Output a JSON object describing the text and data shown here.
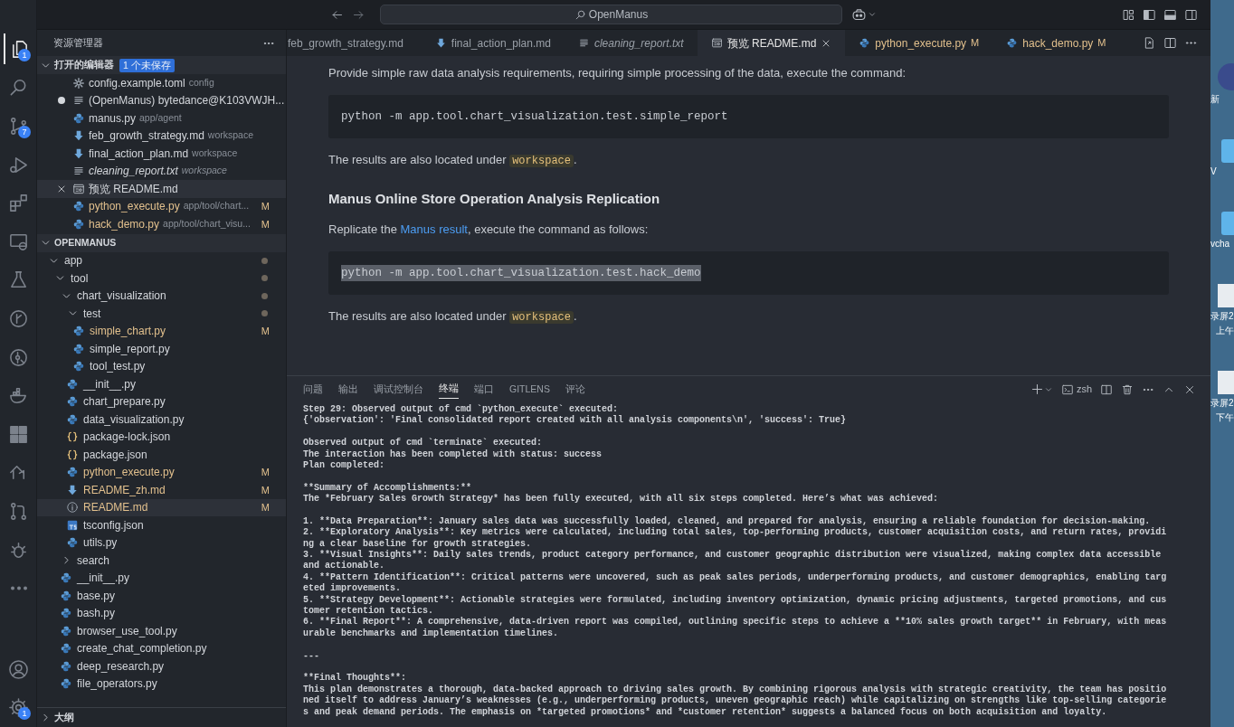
{
  "title_bar": {
    "search": "OpenManus"
  },
  "activity_bar": {
    "items": [
      {
        "kind": "files",
        "selected": true,
        "badge": "1"
      },
      {
        "kind": "search",
        "selected": false
      },
      {
        "kind": "source_control",
        "selected": false,
        "badge": "7"
      },
      {
        "kind": "run_debug",
        "selected": false
      },
      {
        "kind": "extensions",
        "selected": false
      },
      {
        "kind": "remote",
        "selected": false
      },
      {
        "kind": "testing",
        "selected": false
      },
      {
        "kind": "git_graph",
        "selected": false
      },
      {
        "kind": "gitlens",
        "selected": false
      },
      {
        "kind": "docker",
        "selected": false
      },
      {
        "kind": "grid",
        "selected": false
      },
      {
        "kind": "remote_repo",
        "selected": false
      },
      {
        "kind": "pull_request",
        "selected": false
      },
      {
        "kind": "bug",
        "selected": false
      },
      {
        "kind": "more",
        "selected": false
      }
    ],
    "bottom": [
      {
        "kind": "account",
        "selected": false
      },
      {
        "kind": "settings",
        "selected": false,
        "badge": "1"
      }
    ]
  },
  "explorer": {
    "title": "资源管理器",
    "open_editors": {
      "title": "打开的编辑器",
      "badge": "1 个未保存",
      "expanded": true,
      "items": [
        {
          "kind": "toml",
          "name": "config.example.toml",
          "path": "config",
          "dirty": false,
          "preview": false,
          "selected": false
        },
        {
          "kind": "text",
          "name": "(OpenManus) bytedance@K103VWJH...",
          "dirty": true,
          "preview": false,
          "selected": false
        },
        {
          "kind": "python",
          "name": "manus.py",
          "path": "app/agent",
          "dirty": false,
          "preview": false,
          "selected": false
        },
        {
          "kind": "markdown",
          "name": "feb_growth_strategy.md",
          "path": "workspace",
          "dirty": false,
          "preview": false,
          "selected": false
        },
        {
          "kind": "markdown",
          "name": "final_action_plan.md",
          "path": "workspace",
          "dirty": false,
          "preview": false,
          "selected": false
        },
        {
          "kind": "text",
          "name": "cleaning_report.txt",
          "path": "workspace",
          "dirty": false,
          "preview": true,
          "selected": false
        },
        {
          "kind": "preview",
          "name": "预览 README.md",
          "dirty": false,
          "preview": false,
          "selected": true
        },
        {
          "kind": "python",
          "name": "python_execute.py",
          "path": "app/tool/chart...",
          "git": "M",
          "dirty": false,
          "preview": false,
          "selected": false
        },
        {
          "kind": "python",
          "name": "hack_demo.py",
          "path": "app/tool/chart_visu...",
          "git": "M",
          "dirty": false,
          "preview": false,
          "selected": false
        }
      ]
    },
    "project": {
      "title": "OPENMANUS",
      "expanded": true,
      "tree": [
        {
          "kind": "folder",
          "name": "app",
          "expanded": true,
          "modified": true,
          "selected": false,
          "children": [
            {
              "kind": "folder",
              "name": "tool",
              "expanded": true,
              "modified": true,
              "selected": false,
              "children": [
                {
                  "kind": "folder",
                  "name": "chart_visualization",
                  "expanded": true,
                  "modified": true,
                  "selected": false,
                  "children": [
                    {
                      "kind": "folder",
                      "name": "test",
                      "expanded": true,
                      "modified": true,
                      "selected": false,
                      "children": [
                        {
                          "kind": "python",
                          "name": "simple_chart.py",
                          "git": "M",
                          "selected": false
                        },
                        {
                          "kind": "python",
                          "name": "simple_report.py",
                          "selected": false
                        },
                        {
                          "kind": "python",
                          "name": "tool_test.py",
                          "selected": false
                        }
                      ]
                    },
                    {
                      "kind": "python",
                      "name": "__init__.py",
                      "selected": false
                    },
                    {
                      "kind": "python",
                      "name": "chart_prepare.py",
                      "selected": false
                    },
                    {
                      "kind": "python",
                      "name": "data_visualization.py",
                      "selected": false
                    },
                    {
                      "kind": "json",
                      "name": "package-lock.json",
                      "selected": false
                    },
                    {
                      "kind": "json",
                      "name": "package.json",
                      "selected": false
                    },
                    {
                      "kind": "python",
                      "name": "python_execute.py",
                      "git": "M",
                      "selected": false
                    },
                    {
                      "kind": "markdown",
                      "name": "README_zh.md",
                      "git": "M",
                      "selected": false
                    },
                    {
                      "kind": "info",
                      "name": "README.md",
                      "git": "M",
                      "selected": true
                    },
                    {
                      "kind": "ts",
                      "name": "tsconfig.json",
                      "selected": false
                    },
                    {
                      "kind": "python",
                      "name": "utils.py",
                      "selected": false
                    }
                  ]
                },
                {
                  "kind": "folder",
                  "name": "search",
                  "expanded": false,
                  "modified": false,
                  "selected": false
                },
                {
                  "kind": "python",
                  "name": "__init__.py",
                  "selected": false
                },
                {
                  "kind": "python",
                  "name": "base.py",
                  "selected": false
                },
                {
                  "kind": "python",
                  "name": "bash.py",
                  "selected": false
                },
                {
                  "kind": "python",
                  "name": "browser_use_tool.py",
                  "selected": false
                },
                {
                  "kind": "python",
                  "name": "create_chat_completion.py",
                  "selected": false
                },
                {
                  "kind": "python",
                  "name": "deep_research.py",
                  "selected": false
                },
                {
                  "kind": "python",
                  "name": "file_operators.py",
                  "selected": false
                }
              ]
            }
          ]
        }
      ]
    },
    "outline": {
      "title": "大纲",
      "expanded": false
    }
  },
  "tabs": [
    {
      "label": "feb_growth_strategy.md",
      "selected": false,
      "preview": false
    },
    {
      "kind": "markdown",
      "label": "final_action_plan.md",
      "selected": false,
      "preview": false
    },
    {
      "kind": "text",
      "label": "cleaning_report.txt",
      "selected": false,
      "preview": true
    },
    {
      "kind": "preview",
      "label": "预览 README.md",
      "selected": true,
      "preview": false
    },
    {
      "kind": "python",
      "label": "python_execute.py",
      "git": "M",
      "selected": false,
      "preview": false
    },
    {
      "kind": "python",
      "label": "hack_demo.py",
      "git": "M",
      "selected": false,
      "preview": false
    }
  ],
  "document": [
    {
      "kind": "paragraph",
      "parts": [
        {
          "kind": "text",
          "text": "Provide simple raw data analysis requirements, requiring simple processing of the data, execute the command:"
        }
      ]
    },
    {
      "kind": "code",
      "text": "python -m app.tool.chart_visualization.test.simple_report",
      "selected": false
    },
    {
      "kind": "paragraph",
      "parts": [
        {
          "kind": "text",
          "text": "The results are also located under "
        },
        {
          "kind": "code",
          "text": "workspace"
        },
        {
          "kind": "text",
          "text": "."
        }
      ]
    },
    {
      "kind": "heading",
      "text": "Manus Online Store Operation Analysis Replication"
    },
    {
      "kind": "paragraph",
      "parts": [
        {
          "kind": "text",
          "text": "Replicate the "
        },
        {
          "kind": "link",
          "text": "Manus result"
        },
        {
          "kind": "text",
          "text": ", execute the command as follows:"
        }
      ]
    },
    {
      "kind": "code",
      "text": "python -m app.tool.chart_visualization.test.hack_demo",
      "selected": true
    },
    {
      "kind": "paragraph",
      "parts": [
        {
          "kind": "text",
          "text": "The results are also located under "
        },
        {
          "kind": "code",
          "text": "workspace"
        },
        {
          "kind": "text",
          "text": "."
        }
      ]
    }
  ],
  "panel": {
    "tabs": [
      {
        "label": "问题",
        "selected": false
      },
      {
        "label": "输出",
        "selected": false
      },
      {
        "label": "调试控制台",
        "selected": false
      },
      {
        "label": "终端",
        "selected": true
      },
      {
        "label": "端口",
        "selected": false
      },
      {
        "label": "GITLENS",
        "selected": false
      },
      {
        "label": "评论",
        "selected": false
      }
    ],
    "shell": "zsh",
    "terminal": [
      [
        "Step 29: Observed output of cmd `python_execute` executed:",
        "{'observation': 'Final consolidated report created with all analysis components\\n', 'success': True}"
      ],
      [
        "Observed output of cmd `terminate` executed:",
        "The interaction has been completed with status: success",
        "Plan completed:"
      ],
      [
        "**Summary of Accomplishments:**",
        "The *February Sales Growth Strategy* has been fully executed, with all six steps completed. Here’s what was achieved:"
      ],
      [
        "1. **Data Preparation**: January sales data was successfully loaded, cleaned, and prepared for analysis, ensuring a reliable foundation for decision-making.",
        "2. **Exploratory Analysis**: Key metrics were calculated, including total sales, top-performing products, customer acquisition costs, and return rates, providi",
        "ng a clear baseline for growth strategies.",
        "3. **Visual Insights**: Daily sales trends, product category performance, and customer geographic distribution were visualized, making complex data accessible",
        "and actionable.",
        "4. **Pattern Identification**: Critical patterns were uncovered, such as peak sales periods, underperforming products, and customer demographics, enabling targ",
        "eted improvements.",
        "5. **Strategy Development**: Actionable strategies were formulated, including inventory optimization, dynamic pricing adjustments, targeted promotions, and cus",
        "tomer retention tactics.",
        "6. **Final Report**: A comprehensive, data-driven report was compiled, outlining specific steps to achieve a **10% sales growth target** in February, with meas",
        "urable benchmarks and implementation timelines."
      ],
      [
        "---"
      ],
      [
        "**Final Thoughts**:",
        "This plan demonstrates a thorough, data-backed approach to driving sales growth. By combining rigorous analysis with strategic creativity, the team has positio",
        "ned itself to address January’s weaknesses (e.g., underperforming products, uneven geographic reach) while capitalizing on strengths like top-selling categorie",
        "s and peak demand periods. The emphasis on *targeted promotions* and *customer retention* suggests a balanced focus on both acquisition and loyalty."
      ]
    ]
  },
  "desktop": {
    "items": [
      {
        "kind": "app",
        "label": "新"
      },
      {
        "kind": "folder",
        "label": "V"
      },
      {
        "kind": "folder",
        "label": "vcha"
      },
      {
        "kind": "screenshot",
        "label": "录屏2",
        "sublabel": "上午"
      },
      {
        "kind": "screenshot",
        "label": "录屏2",
        "sublabel": "下午"
      }
    ]
  }
}
